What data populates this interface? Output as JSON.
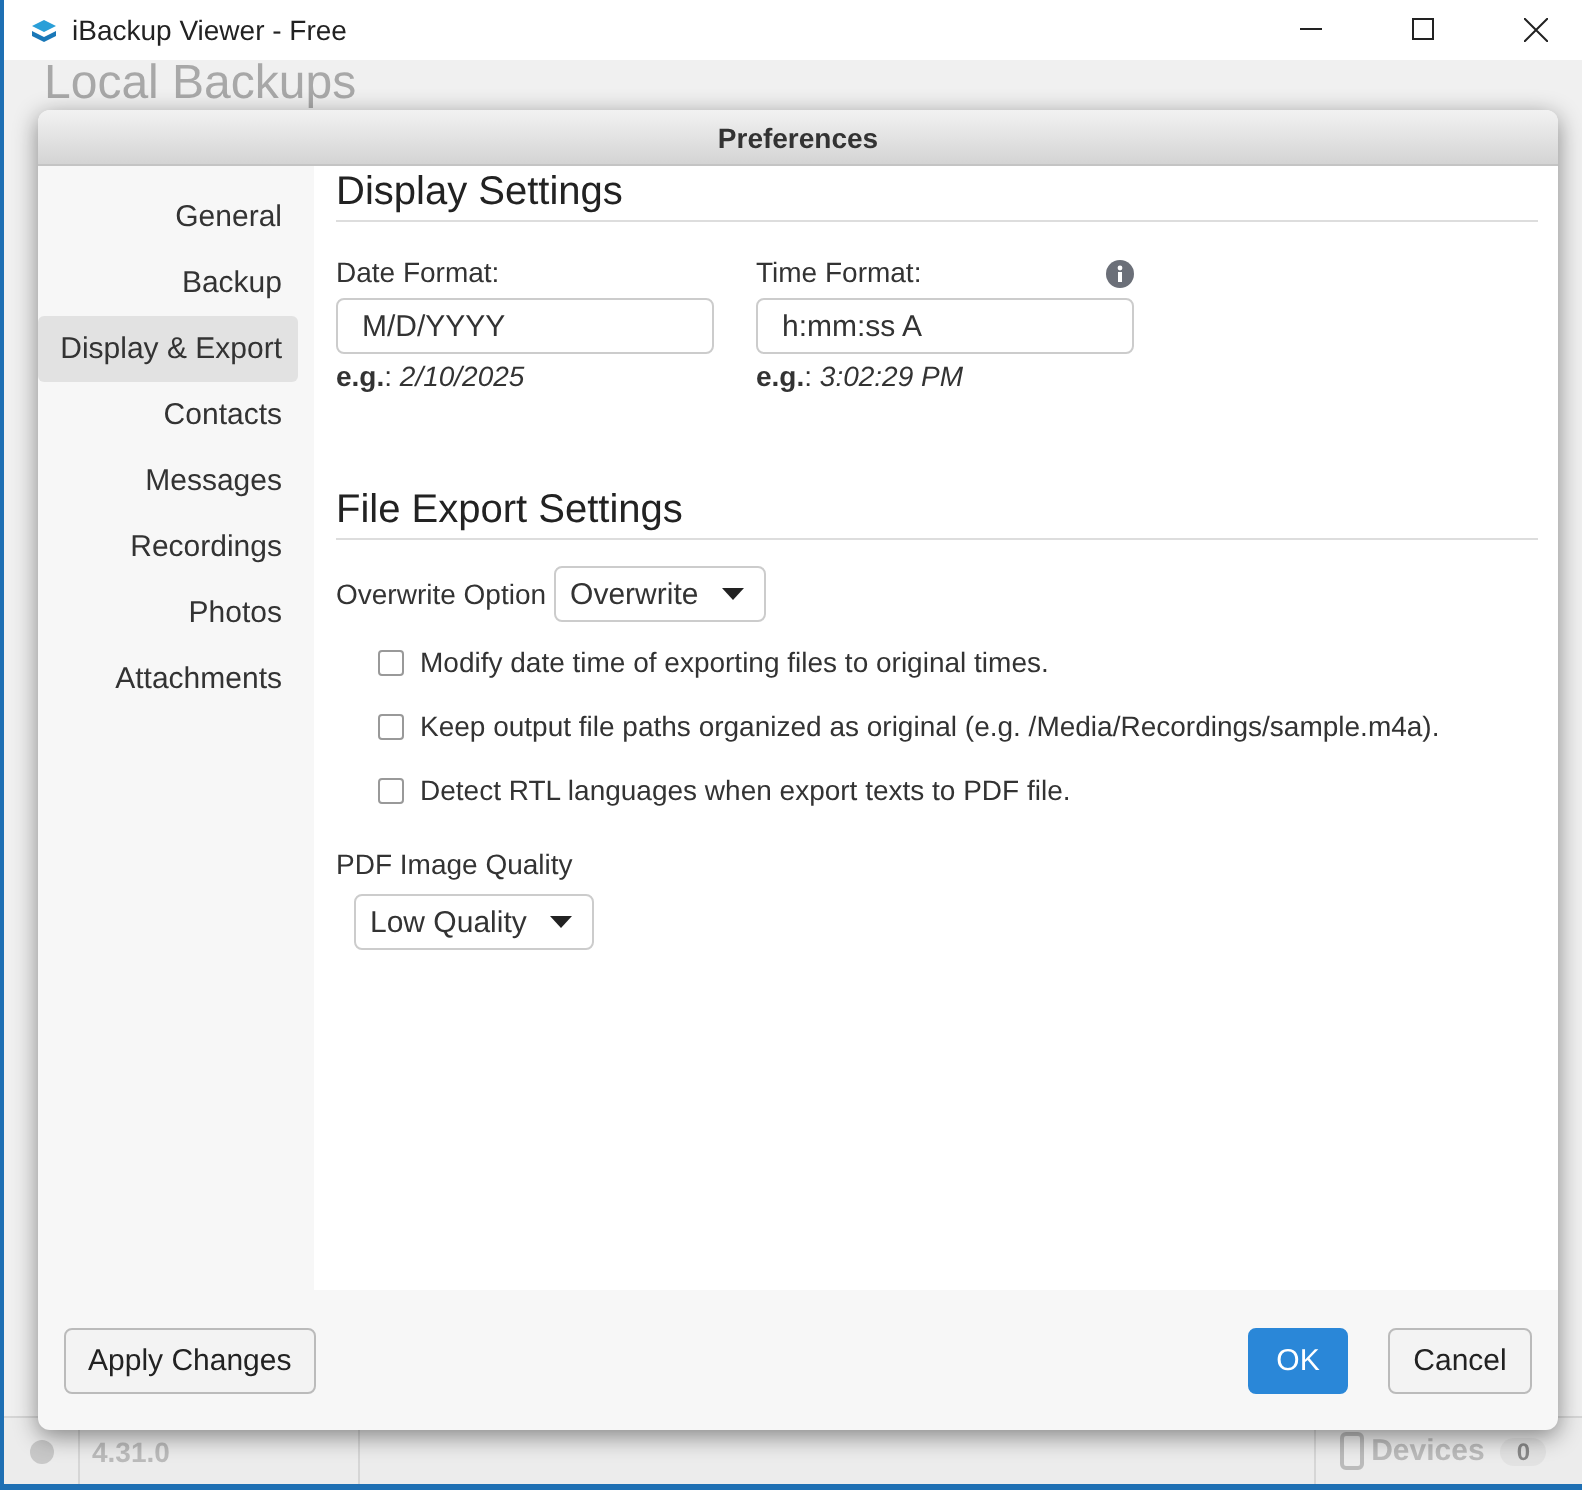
{
  "window": {
    "title": "iBackup Viewer - Free"
  },
  "background": {
    "heading": "Local Backups"
  },
  "dialog": {
    "title": "Preferences",
    "sidebar": [
      {
        "label": "General",
        "selected": false
      },
      {
        "label": "Backup",
        "selected": false
      },
      {
        "label": "Display & Export",
        "selected": true
      },
      {
        "label": "Contacts",
        "selected": false
      },
      {
        "label": "Messages",
        "selected": false
      },
      {
        "label": "Recordings",
        "selected": false
      },
      {
        "label": "Photos",
        "selected": false
      },
      {
        "label": "Attachments",
        "selected": false
      }
    ],
    "display_settings": {
      "heading": "Display Settings",
      "fields": [
        {
          "label": "Date Format:",
          "value": "M/D/YYYY",
          "example": "**e.g.**: *2/10/2025*"
        },
        {
          "label": "Time Format:",
          "value": "h:mm:ss A",
          "example": "**e.g.**: *3:02:29 PM*"
        }
      ]
    },
    "file_export_settings": {
      "heading": "File Export Settings",
      "overwrite": {
        "label": "Overwrite Option",
        "value": "Overwrite"
      },
      "options": [
        {
          "label": "Modify date time of exporting files to original times.",
          "checked": false
        },
        {
          "label": "Keep output file paths organized as original (e.g. /Media/Recordings/sample.m4a).",
          "checked": false
        },
        {
          "label": "Detect RTL languages when export texts to PDF file.",
          "checked": false
        }
      ],
      "pdf_quality": {
        "label": "PDF Image Quality",
        "value": "Low Quality"
      }
    },
    "buttons": {
      "apply": "Apply Changes",
      "ok": "OK",
      "cancel": "Cancel"
    }
  },
  "status_bar": {
    "version": "4.31.0",
    "devices_label": "Devices",
    "devices_count": "0"
  }
}
